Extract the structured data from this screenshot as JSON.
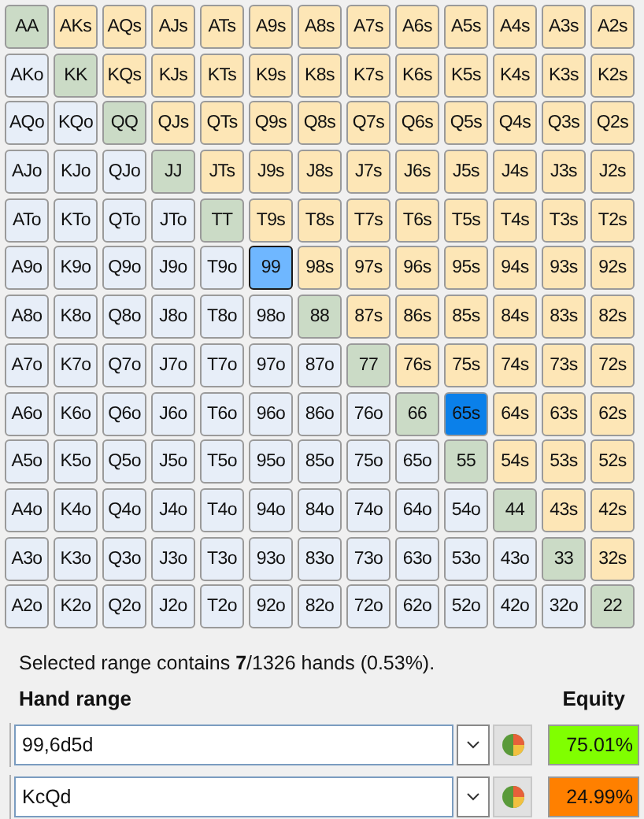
{
  "grid": [
    [
      {
        "label": "AA",
        "kind": "pair",
        "selected": false,
        "focused": false
      },
      {
        "label": "AKs",
        "kind": "suited",
        "selected": false,
        "focused": false
      },
      {
        "label": "AQs",
        "kind": "suited",
        "selected": false,
        "focused": false
      },
      {
        "label": "AJs",
        "kind": "suited",
        "selected": false,
        "focused": false
      },
      {
        "label": "ATs",
        "kind": "suited",
        "selected": false,
        "focused": false
      },
      {
        "label": "A9s",
        "kind": "suited",
        "selected": false,
        "focused": false
      },
      {
        "label": "A8s",
        "kind": "suited",
        "selected": false,
        "focused": false
      },
      {
        "label": "A7s",
        "kind": "suited",
        "selected": false,
        "focused": false
      },
      {
        "label": "A6s",
        "kind": "suited",
        "selected": false,
        "focused": false
      },
      {
        "label": "A5s",
        "kind": "suited",
        "selected": false,
        "focused": false
      },
      {
        "label": "A4s",
        "kind": "suited",
        "selected": false,
        "focused": false
      },
      {
        "label": "A3s",
        "kind": "suited",
        "selected": false,
        "focused": false
      },
      {
        "label": "A2s",
        "kind": "suited",
        "selected": false,
        "focused": false
      }
    ],
    [
      {
        "label": "AKo",
        "kind": "offsuit",
        "selected": false,
        "focused": false
      },
      {
        "label": "KK",
        "kind": "pair",
        "selected": false,
        "focused": false
      },
      {
        "label": "KQs",
        "kind": "suited",
        "selected": false,
        "focused": false
      },
      {
        "label": "KJs",
        "kind": "suited",
        "selected": false,
        "focused": false
      },
      {
        "label": "KTs",
        "kind": "suited",
        "selected": false,
        "focused": false
      },
      {
        "label": "K9s",
        "kind": "suited",
        "selected": false,
        "focused": false
      },
      {
        "label": "K8s",
        "kind": "suited",
        "selected": false,
        "focused": false
      },
      {
        "label": "K7s",
        "kind": "suited",
        "selected": false,
        "focused": false
      },
      {
        "label": "K6s",
        "kind": "suited",
        "selected": false,
        "focused": false
      },
      {
        "label": "K5s",
        "kind": "suited",
        "selected": false,
        "focused": false
      },
      {
        "label": "K4s",
        "kind": "suited",
        "selected": false,
        "focused": false
      },
      {
        "label": "K3s",
        "kind": "suited",
        "selected": false,
        "focused": false
      },
      {
        "label": "K2s",
        "kind": "suited",
        "selected": false,
        "focused": false
      }
    ],
    [
      {
        "label": "AQo",
        "kind": "offsuit",
        "selected": false,
        "focused": false
      },
      {
        "label": "KQo",
        "kind": "offsuit",
        "selected": false,
        "focused": false
      },
      {
        "label": "QQ",
        "kind": "pair",
        "selected": false,
        "focused": false
      },
      {
        "label": "QJs",
        "kind": "suited",
        "selected": false,
        "focused": false
      },
      {
        "label": "QTs",
        "kind": "suited",
        "selected": false,
        "focused": false
      },
      {
        "label": "Q9s",
        "kind": "suited",
        "selected": false,
        "focused": false
      },
      {
        "label": "Q8s",
        "kind": "suited",
        "selected": false,
        "focused": false
      },
      {
        "label": "Q7s",
        "kind": "suited",
        "selected": false,
        "focused": false
      },
      {
        "label": "Q6s",
        "kind": "suited",
        "selected": false,
        "focused": false
      },
      {
        "label": "Q5s",
        "kind": "suited",
        "selected": false,
        "focused": false
      },
      {
        "label": "Q4s",
        "kind": "suited",
        "selected": false,
        "focused": false
      },
      {
        "label": "Q3s",
        "kind": "suited",
        "selected": false,
        "focused": false
      },
      {
        "label": "Q2s",
        "kind": "suited",
        "selected": false,
        "focused": false
      }
    ],
    [
      {
        "label": "AJo",
        "kind": "offsuit",
        "selected": false,
        "focused": false
      },
      {
        "label": "KJo",
        "kind": "offsuit",
        "selected": false,
        "focused": false
      },
      {
        "label": "QJo",
        "kind": "offsuit",
        "selected": false,
        "focused": false
      },
      {
        "label": "JJ",
        "kind": "pair",
        "selected": false,
        "focused": false
      },
      {
        "label": "JTs",
        "kind": "suited",
        "selected": false,
        "focused": false
      },
      {
        "label": "J9s",
        "kind": "suited",
        "selected": false,
        "focused": false
      },
      {
        "label": "J8s",
        "kind": "suited",
        "selected": false,
        "focused": false
      },
      {
        "label": "J7s",
        "kind": "suited",
        "selected": false,
        "focused": false
      },
      {
        "label": "J6s",
        "kind": "suited",
        "selected": false,
        "focused": false
      },
      {
        "label": "J5s",
        "kind": "suited",
        "selected": false,
        "focused": false
      },
      {
        "label": "J4s",
        "kind": "suited",
        "selected": false,
        "focused": false
      },
      {
        "label": "J3s",
        "kind": "suited",
        "selected": false,
        "focused": false
      },
      {
        "label": "J2s",
        "kind": "suited",
        "selected": false,
        "focused": false
      }
    ],
    [
      {
        "label": "ATo",
        "kind": "offsuit",
        "selected": false,
        "focused": false
      },
      {
        "label": "KTo",
        "kind": "offsuit",
        "selected": false,
        "focused": false
      },
      {
        "label": "QTo",
        "kind": "offsuit",
        "selected": false,
        "focused": false
      },
      {
        "label": "JTo",
        "kind": "offsuit",
        "selected": false,
        "focused": false
      },
      {
        "label": "TT",
        "kind": "pair",
        "selected": false,
        "focused": false
      },
      {
        "label": "T9s",
        "kind": "suited",
        "selected": false,
        "focused": false
      },
      {
        "label": "T8s",
        "kind": "suited",
        "selected": false,
        "focused": false
      },
      {
        "label": "T7s",
        "kind": "suited",
        "selected": false,
        "focused": false
      },
      {
        "label": "T6s",
        "kind": "suited",
        "selected": false,
        "focused": false
      },
      {
        "label": "T5s",
        "kind": "suited",
        "selected": false,
        "focused": false
      },
      {
        "label": "T4s",
        "kind": "suited",
        "selected": false,
        "focused": false
      },
      {
        "label": "T3s",
        "kind": "suited",
        "selected": false,
        "focused": false
      },
      {
        "label": "T2s",
        "kind": "suited",
        "selected": false,
        "focused": false
      }
    ],
    [
      {
        "label": "A9o",
        "kind": "offsuit",
        "selected": false,
        "focused": false
      },
      {
        "label": "K9o",
        "kind": "offsuit",
        "selected": false,
        "focused": false
      },
      {
        "label": "Q9o",
        "kind": "offsuit",
        "selected": false,
        "focused": false
      },
      {
        "label": "J9o",
        "kind": "offsuit",
        "selected": false,
        "focused": false
      },
      {
        "label": "T9o",
        "kind": "offsuit",
        "selected": false,
        "focused": false
      },
      {
        "label": "99",
        "kind": "pair",
        "selected": true,
        "focused": true
      },
      {
        "label": "98s",
        "kind": "suited",
        "selected": false,
        "focused": false
      },
      {
        "label": "97s",
        "kind": "suited",
        "selected": false,
        "focused": false
      },
      {
        "label": "96s",
        "kind": "suited",
        "selected": false,
        "focused": false
      },
      {
        "label": "95s",
        "kind": "suited",
        "selected": false,
        "focused": false
      },
      {
        "label": "94s",
        "kind": "suited",
        "selected": false,
        "focused": false
      },
      {
        "label": "93s",
        "kind": "suited",
        "selected": false,
        "focused": false
      },
      {
        "label": "92s",
        "kind": "suited",
        "selected": false,
        "focused": false
      }
    ],
    [
      {
        "label": "A8o",
        "kind": "offsuit",
        "selected": false,
        "focused": false
      },
      {
        "label": "K8o",
        "kind": "offsuit",
        "selected": false,
        "focused": false
      },
      {
        "label": "Q8o",
        "kind": "offsuit",
        "selected": false,
        "focused": false
      },
      {
        "label": "J8o",
        "kind": "offsuit",
        "selected": false,
        "focused": false
      },
      {
        "label": "T8o",
        "kind": "offsuit",
        "selected": false,
        "focused": false
      },
      {
        "label": "98o",
        "kind": "offsuit",
        "selected": false,
        "focused": false
      },
      {
        "label": "88",
        "kind": "pair",
        "selected": false,
        "focused": false
      },
      {
        "label": "87s",
        "kind": "suited",
        "selected": false,
        "focused": false
      },
      {
        "label": "86s",
        "kind": "suited",
        "selected": false,
        "focused": false
      },
      {
        "label": "85s",
        "kind": "suited",
        "selected": false,
        "focused": false
      },
      {
        "label": "84s",
        "kind": "suited",
        "selected": false,
        "focused": false
      },
      {
        "label": "83s",
        "kind": "suited",
        "selected": false,
        "focused": false
      },
      {
        "label": "82s",
        "kind": "suited",
        "selected": false,
        "focused": false
      }
    ],
    [
      {
        "label": "A7o",
        "kind": "offsuit",
        "selected": false,
        "focused": false
      },
      {
        "label": "K7o",
        "kind": "offsuit",
        "selected": false,
        "focused": false
      },
      {
        "label": "Q7o",
        "kind": "offsuit",
        "selected": false,
        "focused": false
      },
      {
        "label": "J7o",
        "kind": "offsuit",
        "selected": false,
        "focused": false
      },
      {
        "label": "T7o",
        "kind": "offsuit",
        "selected": false,
        "focused": false
      },
      {
        "label": "97o",
        "kind": "offsuit",
        "selected": false,
        "focused": false
      },
      {
        "label": "87o",
        "kind": "offsuit",
        "selected": false,
        "focused": false
      },
      {
        "label": "77",
        "kind": "pair",
        "selected": false,
        "focused": false
      },
      {
        "label": "76s",
        "kind": "suited",
        "selected": false,
        "focused": false
      },
      {
        "label": "75s",
        "kind": "suited",
        "selected": false,
        "focused": false
      },
      {
        "label": "74s",
        "kind": "suited",
        "selected": false,
        "focused": false
      },
      {
        "label": "73s",
        "kind": "suited",
        "selected": false,
        "focused": false
      },
      {
        "label": "72s",
        "kind": "suited",
        "selected": false,
        "focused": false
      }
    ],
    [
      {
        "label": "A6o",
        "kind": "offsuit",
        "selected": false,
        "focused": false
      },
      {
        "label": "K6o",
        "kind": "offsuit",
        "selected": false,
        "focused": false
      },
      {
        "label": "Q6o",
        "kind": "offsuit",
        "selected": false,
        "focused": false
      },
      {
        "label": "J6o",
        "kind": "offsuit",
        "selected": false,
        "focused": false
      },
      {
        "label": "T6o",
        "kind": "offsuit",
        "selected": false,
        "focused": false
      },
      {
        "label": "96o",
        "kind": "offsuit",
        "selected": false,
        "focused": false
      },
      {
        "label": "86o",
        "kind": "offsuit",
        "selected": false,
        "focused": false
      },
      {
        "label": "76o",
        "kind": "offsuit",
        "selected": false,
        "focused": false
      },
      {
        "label": "66",
        "kind": "pair",
        "selected": false,
        "focused": false
      },
      {
        "label": "65s",
        "kind": "suited",
        "selected": true,
        "focused": false
      },
      {
        "label": "64s",
        "kind": "suited",
        "selected": false,
        "focused": false
      },
      {
        "label": "63s",
        "kind": "suited",
        "selected": false,
        "focused": false
      },
      {
        "label": "62s",
        "kind": "suited",
        "selected": false,
        "focused": false
      }
    ],
    [
      {
        "label": "A5o",
        "kind": "offsuit",
        "selected": false,
        "focused": false
      },
      {
        "label": "K5o",
        "kind": "offsuit",
        "selected": false,
        "focused": false
      },
      {
        "label": "Q5o",
        "kind": "offsuit",
        "selected": false,
        "focused": false
      },
      {
        "label": "J5o",
        "kind": "offsuit",
        "selected": false,
        "focused": false
      },
      {
        "label": "T5o",
        "kind": "offsuit",
        "selected": false,
        "focused": false
      },
      {
        "label": "95o",
        "kind": "offsuit",
        "selected": false,
        "focused": false
      },
      {
        "label": "85o",
        "kind": "offsuit",
        "selected": false,
        "focused": false
      },
      {
        "label": "75o",
        "kind": "offsuit",
        "selected": false,
        "focused": false
      },
      {
        "label": "65o",
        "kind": "offsuit",
        "selected": false,
        "focused": false
      },
      {
        "label": "55",
        "kind": "pair",
        "selected": false,
        "focused": false
      },
      {
        "label": "54s",
        "kind": "suited",
        "selected": false,
        "focused": false
      },
      {
        "label": "53s",
        "kind": "suited",
        "selected": false,
        "focused": false
      },
      {
        "label": "52s",
        "kind": "suited",
        "selected": false,
        "focused": false
      }
    ],
    [
      {
        "label": "A4o",
        "kind": "offsuit",
        "selected": false,
        "focused": false
      },
      {
        "label": "K4o",
        "kind": "offsuit",
        "selected": false,
        "focused": false
      },
      {
        "label": "Q4o",
        "kind": "offsuit",
        "selected": false,
        "focused": false
      },
      {
        "label": "J4o",
        "kind": "offsuit",
        "selected": false,
        "focused": false
      },
      {
        "label": "T4o",
        "kind": "offsuit",
        "selected": false,
        "focused": false
      },
      {
        "label": "94o",
        "kind": "offsuit",
        "selected": false,
        "focused": false
      },
      {
        "label": "84o",
        "kind": "offsuit",
        "selected": false,
        "focused": false
      },
      {
        "label": "74o",
        "kind": "offsuit",
        "selected": false,
        "focused": false
      },
      {
        "label": "64o",
        "kind": "offsuit",
        "selected": false,
        "focused": false
      },
      {
        "label": "54o",
        "kind": "offsuit",
        "selected": false,
        "focused": false
      },
      {
        "label": "44",
        "kind": "pair",
        "selected": false,
        "focused": false
      },
      {
        "label": "43s",
        "kind": "suited",
        "selected": false,
        "focused": false
      },
      {
        "label": "42s",
        "kind": "suited",
        "selected": false,
        "focused": false
      }
    ],
    [
      {
        "label": "A3o",
        "kind": "offsuit",
        "selected": false,
        "focused": false
      },
      {
        "label": "K3o",
        "kind": "offsuit",
        "selected": false,
        "focused": false
      },
      {
        "label": "Q3o",
        "kind": "offsuit",
        "selected": false,
        "focused": false
      },
      {
        "label": "J3o",
        "kind": "offsuit",
        "selected": false,
        "focused": false
      },
      {
        "label": "T3o",
        "kind": "offsuit",
        "selected": false,
        "focused": false
      },
      {
        "label": "93o",
        "kind": "offsuit",
        "selected": false,
        "focused": false
      },
      {
        "label": "83o",
        "kind": "offsuit",
        "selected": false,
        "focused": false
      },
      {
        "label": "73o",
        "kind": "offsuit",
        "selected": false,
        "focused": false
      },
      {
        "label": "63o",
        "kind": "offsuit",
        "selected": false,
        "focused": false
      },
      {
        "label": "53o",
        "kind": "offsuit",
        "selected": false,
        "focused": false
      },
      {
        "label": "43o",
        "kind": "offsuit",
        "selected": false,
        "focused": false
      },
      {
        "label": "33",
        "kind": "pair",
        "selected": false,
        "focused": false
      },
      {
        "label": "32s",
        "kind": "suited",
        "selected": false,
        "focused": false
      }
    ],
    [
      {
        "label": "A2o",
        "kind": "offsuit",
        "selected": false,
        "focused": false
      },
      {
        "label": "K2o",
        "kind": "offsuit",
        "selected": false,
        "focused": false
      },
      {
        "label": "Q2o",
        "kind": "offsuit",
        "selected": false,
        "focused": false
      },
      {
        "label": "J2o",
        "kind": "offsuit",
        "selected": false,
        "focused": false
      },
      {
        "label": "T2o",
        "kind": "offsuit",
        "selected": false,
        "focused": false
      },
      {
        "label": "92o",
        "kind": "offsuit",
        "selected": false,
        "focused": false
      },
      {
        "label": "82o",
        "kind": "offsuit",
        "selected": false,
        "focused": false
      },
      {
        "label": "72o",
        "kind": "offsuit",
        "selected": false,
        "focused": false
      },
      {
        "label": "62o",
        "kind": "offsuit",
        "selected": false,
        "focused": false
      },
      {
        "label": "52o",
        "kind": "offsuit",
        "selected": false,
        "focused": false
      },
      {
        "label": "42o",
        "kind": "offsuit",
        "selected": false,
        "focused": false
      },
      {
        "label": "32o",
        "kind": "offsuit",
        "selected": false,
        "focused": false
      },
      {
        "label": "22",
        "kind": "pair",
        "selected": false,
        "focused": false
      }
    ]
  ],
  "summary": "Selected range contains **7**/1326 hands (0.53%).",
  "headers": {
    "range": "Hand range",
    "equity": "Equity"
  },
  "players": [
    {
      "range": "99,6d5d",
      "equity": "75.01%",
      "color": "#80ff00"
    },
    {
      "range": "KcQd",
      "equity": "24.99%",
      "color": "#ff8000"
    }
  ]
}
